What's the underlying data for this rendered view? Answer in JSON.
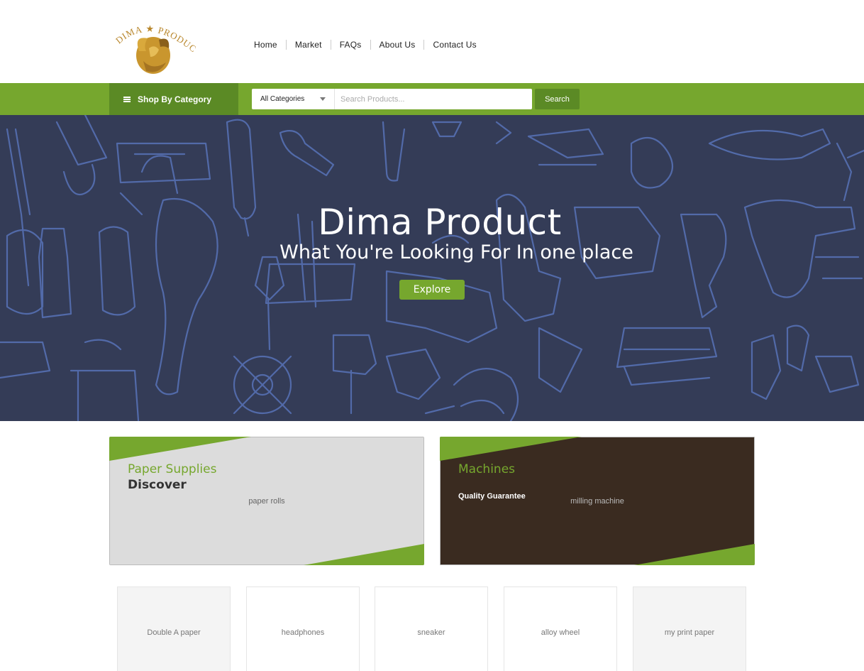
{
  "brand": {
    "logo_text": "Dima Product"
  },
  "nav": {
    "items": [
      "Home",
      "Market",
      "FAQs",
      "About Us",
      "Contact Us"
    ]
  },
  "category_bar": {
    "shop_by_category": "Shop By Category",
    "category_select": "All Categories",
    "search_placeholder": "Search Products...",
    "search_button": "Search"
  },
  "hero": {
    "title": "Dima Product",
    "subtitle": "What You're Looking For In one place",
    "cta": "Explore"
  },
  "banners": [
    {
      "title": "Paper Supplies",
      "subtitle": "Discover",
      "image_label": "paper rolls"
    },
    {
      "title": "Machines",
      "subtitle": "Quality Guarantee",
      "image_label": "milling machine"
    }
  ],
  "products": [
    {
      "image_label": "Double A paper"
    },
    {
      "image_label": "headphones"
    },
    {
      "image_label": "sneaker"
    },
    {
      "image_label": "alloy wheel"
    },
    {
      "image_label": "my print paper"
    }
  ],
  "colors": {
    "accent": "#76a72e",
    "accent_dark": "#5b8a25",
    "hero_bg": "#343c57",
    "pattern": "#5873b8",
    "gold": "#b8862b"
  }
}
